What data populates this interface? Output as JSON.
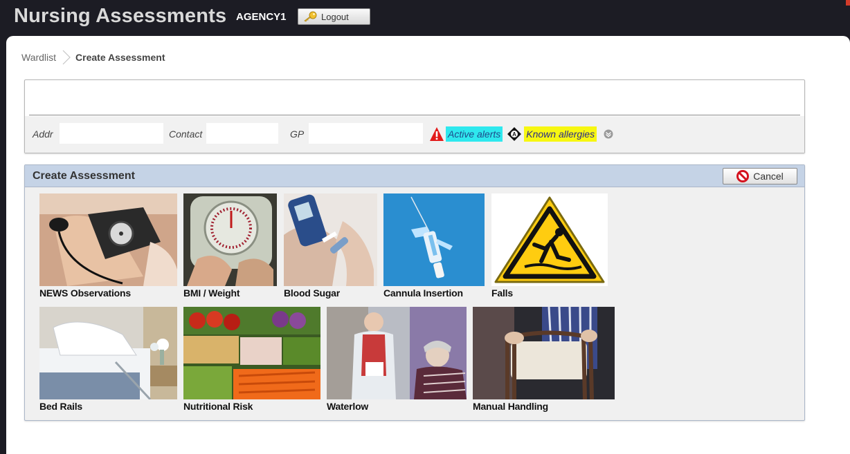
{
  "header": {
    "app_title": "Nursing Assessments",
    "agency": "AGENCY1",
    "logout_label": "Logout"
  },
  "breadcrumb": {
    "items": [
      "Wardlist",
      "Create Assessment"
    ]
  },
  "patient_banner": {
    "addr_label": "Addr",
    "contact_label": "Contact",
    "gp_label": "GP",
    "active_alerts_label": "Active alerts",
    "known_allergies_label": "Known allergies"
  },
  "create_assessment": {
    "title": "Create Assessment",
    "cancel_label": "Cancel",
    "tiles": [
      {
        "label": "NEWS Observations",
        "icon": "blood-pressure-photo"
      },
      {
        "label": "BMI / Weight",
        "icon": "weighing-scale-photo"
      },
      {
        "label": "Blood Sugar",
        "icon": "glucose-meter-photo"
      },
      {
        "label": "Cannula Insertion",
        "icon": "cannula-photo"
      },
      {
        "label": "Falls",
        "icon": "slip-warning-sign"
      },
      {
        "label": "Bed Rails",
        "icon": "hospital-bed-photo"
      },
      {
        "label": "Nutritional Risk",
        "icon": "vegetables-photo"
      },
      {
        "label": "Waterlow",
        "icon": "nurse-patient-photo"
      },
      {
        "label": "Manual Handling",
        "icon": "walking-frame-photo"
      }
    ]
  },
  "colors": {
    "header_bg": "#1c1c24",
    "panel_header_bg": "#c5d3e6",
    "active_alerts_bg": "#2ee8ee",
    "known_allergies_bg": "#f7f711",
    "alert_red": "#e21b1b"
  }
}
